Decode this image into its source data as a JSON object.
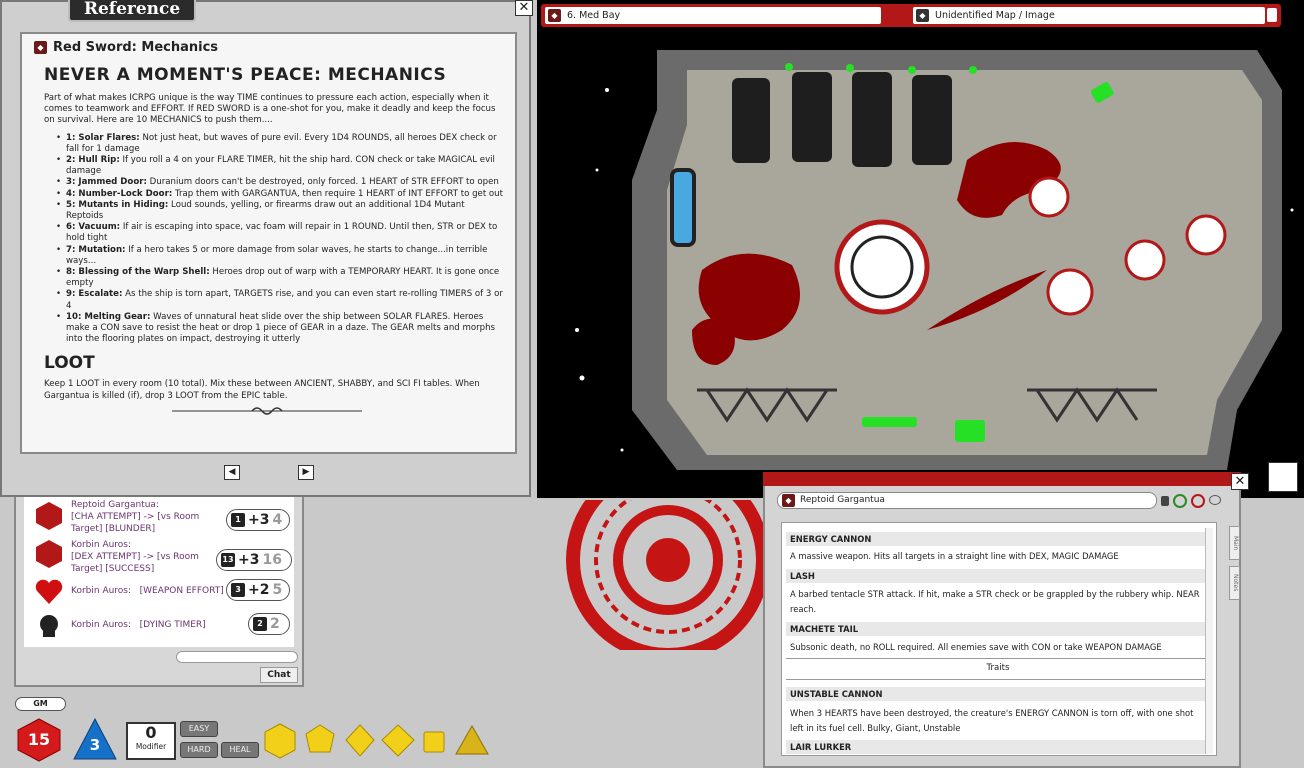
{
  "reference": {
    "header": "Reference",
    "close": "✕",
    "title": "Red Sword: Mechanics",
    "heading": "NEVER A MOMENT'S PEACE: MECHANICS",
    "intro": "Part of what makes ICRPG unique is the way TIME continues to pressure each action, especially when it comes to teamwork and EFFORT. If RED SWORD is a one-shot for you, make it deadly and keep the focus on survival. Here are 10 MECHANICS to push them....",
    "mechanics": [
      {
        "label": "1: Solar Flares:",
        "text": " Not just heat, but waves of pure evil. Every 1D4 ROUNDS, all heroes DEX check or fall for 1 damage"
      },
      {
        "label": "2: Hull Rip:",
        "text": " If you roll a 4 on your FLARE TIMER, hit the ship hard. CON check or take MAGICAL evil damage"
      },
      {
        "label": "3: Jammed Door:",
        "text": " Duranium doors can't be destroyed, only forced. 1 HEART of STR EFFORT to open"
      },
      {
        "label": "4: Number-Lock Door:",
        "text": " Trap them with GARGANTUA, then require 1 HEART of INT EFFORT to get out"
      },
      {
        "label": "5: Mutants in Hiding:",
        "text": " Loud sounds, yelling, or firearms draw out an additional 1D4 Mutant Reptoids"
      },
      {
        "label": "6: Vacuum:",
        "text": " If air is escaping into space, vac foam will repair in 1 ROUND. Until then, STR or DEX to hold tight"
      },
      {
        "label": "7: Mutation:",
        "text": " If a hero takes 5 or more damage from solar waves, he starts to change...in terrible ways..."
      },
      {
        "label": "8: Blessing of the Warp Shell:",
        "text": " Heroes drop out of warp with a TEMPORARY HEART. It is gone once empty"
      },
      {
        "label": "9: Escalate:",
        "text": " As the ship is torn apart, TARGETS rise, and you can even start re-rolling TIMERS of 3 or 4"
      },
      {
        "label": "10: Melting Gear:",
        "text": " Waves of unnatural heat slide over the ship between SOLAR FLARES. Heroes make a CON save to resist the heat or drop 1 piece of GEAR in a daze. The GEAR melts and morphs into the flooring plates on impact, destroying it utterly"
      }
    ],
    "loot_heading": "LOOT",
    "loot_text": "Keep 1 LOOT in every room (10 total). Mix these between ANCIENT, SHABBY, and SCI FI tables. When Gargantua is killed (if), drop 3 LOOT from the EPIC table.",
    "nav_prev": "◀",
    "nav_next": "▶"
  },
  "map": {
    "tab_room": "6. Med Bay",
    "tab_image": "Unidentified Map / Image"
  },
  "chat": {
    "entries": [
      {
        "line1": "Reptoid Gargantua:",
        "line2": "[CHA ATTEMPT] -> [vs Room",
        "line3": "Target] [BLUNDER]",
        "die": "1",
        "total": "+3",
        "target": "4"
      },
      {
        "line1": "Korbin Auros:",
        "line2": "[DEX ATTEMPT] -> [vs Room",
        "line3": "Target] [SUCCESS]",
        "die": "13",
        "total": "+3",
        "target": "16"
      },
      {
        "line1": "Korbin Auros:",
        "line2": "[WEAPON EFFORT]",
        "die": "3",
        "total": "+2",
        "target": "5"
      },
      {
        "line1": "Korbin Auros:",
        "line2": "[DYING TIMER]",
        "die": "2",
        "total": "",
        "target": "2"
      }
    ],
    "send_label": "Chat"
  },
  "toolbar": {
    "gm_label": "GM",
    "d20_value": "15",
    "d4_value": "3",
    "modifier_value": "0",
    "modifier_label": "Modifier",
    "easy_label": "EASY",
    "hard_label": "HARD",
    "heal_label": "HEAL",
    "dice": [
      "d20",
      "d12",
      "d10",
      "d8",
      "d6",
      "d4"
    ]
  },
  "creature": {
    "name": "Reptoid Gargantua",
    "close": "✕",
    "sections": [
      {
        "title": "ENERGY CANNON",
        "text": "A massive weapon. Hits all targets in a straight line with DEX, MAGIC DAMAGE"
      },
      {
        "title": "LASH",
        "text": "A barbed tentacle STR attack. If hit, make a STR check or be grappled by the rubbery whip. NEAR",
        "text2": "reach."
      },
      {
        "title": "MACHETE TAIL",
        "text": "Subsonic death, no ROLL required. All enemies save with CON or take WEAPON DAMAGE"
      }
    ],
    "traits_heading": "Traits",
    "traits": [
      {
        "title": "UNSTABLE CANNON",
        "text": "When 3 HEARTS have been destroyed, the creature's ENERGY CANNON is torn off, with one shot",
        "text2": "left in its fuel cell. Bulky, Giant, Unstable"
      },
      {
        "title": "LAIR LURKER"
      }
    ],
    "side_tabs": [
      "Main",
      "Notes"
    ]
  },
  "colors": {
    "accent_red": "#b31818",
    "blood_red": "#8b0000",
    "glow_green": "#25e025",
    "panel_gray": "#a9a69c"
  }
}
